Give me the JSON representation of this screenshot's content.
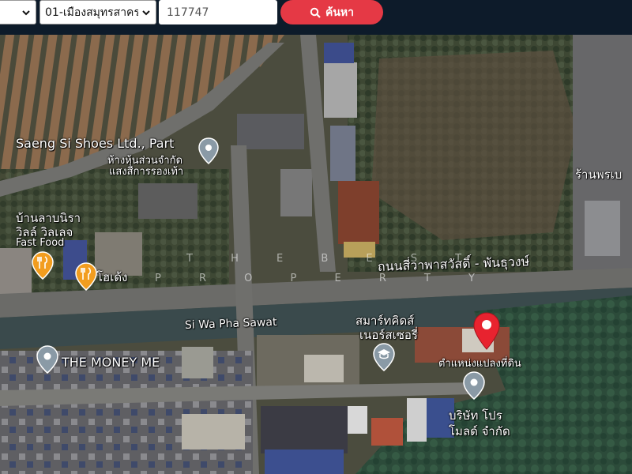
{
  "search": {
    "province_select": "",
    "district_select": "01-เมืองสมุทรสาคร",
    "query_value": "117747",
    "button_label": "ค้นหา"
  },
  "map": {
    "labels": {
      "saeng_si_en": "Saeng Si Shoes Ltd., Part",
      "saeng_si_th_1": "ห้างหุ้นส่วนจำกัด",
      "saeng_si_th_2": "แสงสีการรองเท้า",
      "ban_lap_1": "บ้านลาบนิรา",
      "ban_lap_2": "วิลล์ วิลเลจ",
      "fast_food": "Fast Food",
      "hodeng": "โฮเด้ง",
      "road_th": "ถนนสี่วาพาสวัสดิ์ - พันธุวงษ์",
      "road_en": "Si Wa Pha Sawat",
      "smart_kids_1": "สมาร์ทคิดส์",
      "smart_kids_2": "เนอร์สเซอรี่",
      "money_me": "THE MONEY ME",
      "parcel_location": "ตำแหน่งแปลงที่ดิน",
      "company_1": "บริษัท โปร",
      "company_2": "โมลด์ จำกัด",
      "shop_right": "ร้านพรเบ"
    },
    "watermark_line_1": "T H E   B E S T",
    "watermark_line_2": "P R O P E R T Y",
    "colors": {
      "marker_red": "#e8232f",
      "poi_gray": "#8a9aa6",
      "poi_orange": "#f29d1f"
    },
    "icons": [
      "location-pin-icon",
      "fork-knife-icon",
      "graduation-cap-icon"
    ]
  }
}
